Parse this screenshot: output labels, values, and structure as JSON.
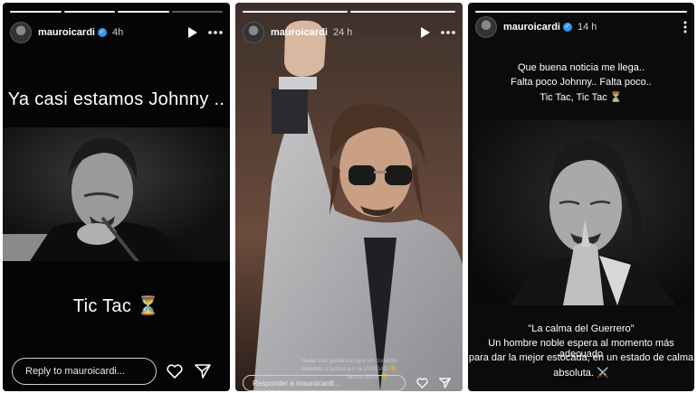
{
  "stories": [
    {
      "username": "mauroicardi",
      "time": "4h",
      "headline": "Ya casi estamos Johnny ..",
      "caption": "Tic Tac ⏳",
      "reply_placeholder": "Reply to mauroicardi..."
    },
    {
      "username": "mauroicardi",
      "time": "24 h",
      "caption_lines": [
        "Nada más poderoso que un corazón",
        "decidido a luchar por la VERDAD 😊",
        "Vamos BIEN 😊"
      ],
      "reply_placeholder": "Responder a mauroicardi..."
    },
    {
      "username": "mauroicardi",
      "time": "14 h",
      "top_lines": [
        "Que buena noticia me llega..",
        "Falta poco Johnny.. Falta poco..",
        "Tic Tac, Tic Tac ⏳"
      ],
      "quote_title": "\"La calma del Guerrero\"",
      "quote_lines": [
        "Un hombre noble espera al momento más adecuado",
        "para dar la mejor estocada, en un estado de calma",
        "absoluta. ⚔️"
      ]
    }
  ],
  "colors": {
    "verified": "#3897f0",
    "background": "#050505"
  },
  "icons": [
    "play-icon",
    "more-icon",
    "heart-icon",
    "send-icon",
    "verified-icon",
    "hourglass-icon"
  ]
}
